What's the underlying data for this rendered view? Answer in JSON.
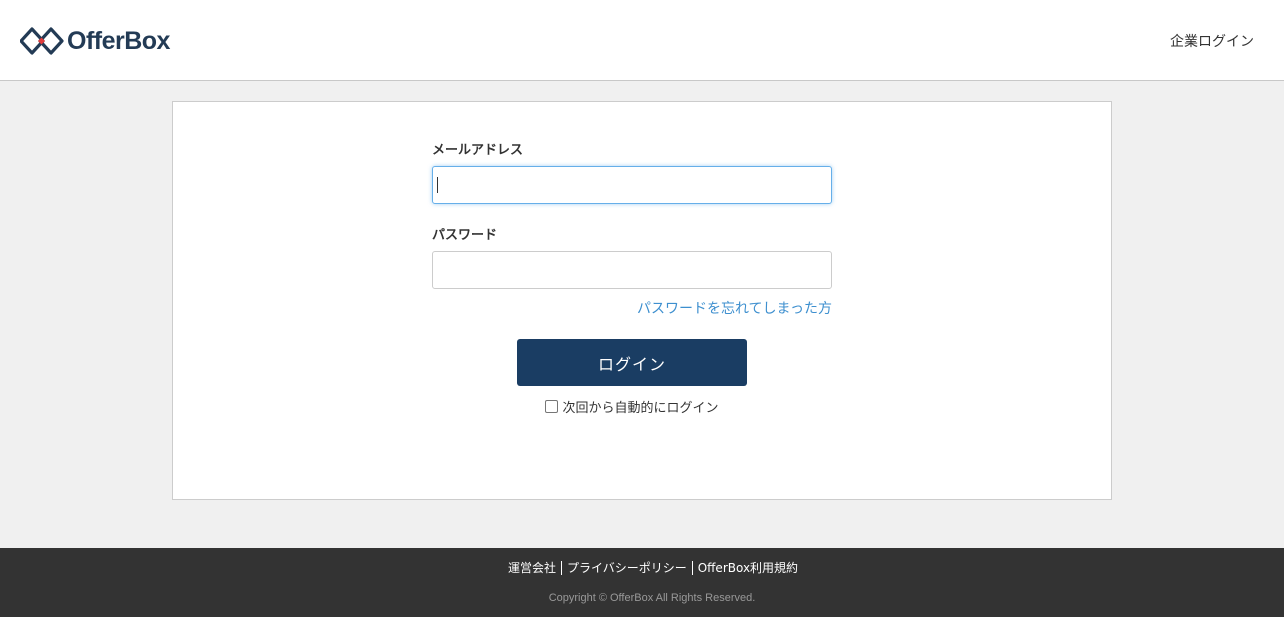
{
  "header": {
    "logo_text": "OfferBox",
    "corp_login_label": "企業ログイン"
  },
  "form": {
    "email_label": "メールアドレス",
    "email_value": "",
    "password_label": "パスワード",
    "password_value": "",
    "forgot_label": "パスワードを忘れてしまった方",
    "login_label": "ログイン",
    "remember_label": "次回から自動的にログイン",
    "remember_checked": false
  },
  "footer": {
    "links": [
      "運営会社",
      "プライバシーポリシー",
      "OfferBox利用規約"
    ],
    "copyright": "Copyright © OfferBox All Rights Reserved."
  },
  "colors": {
    "brand_navy": "#1a3d63",
    "logo_red": "#e03c3c",
    "link_blue": "#3d8fcf",
    "footer_bg": "#333333",
    "focus_border": "#66afe9"
  }
}
